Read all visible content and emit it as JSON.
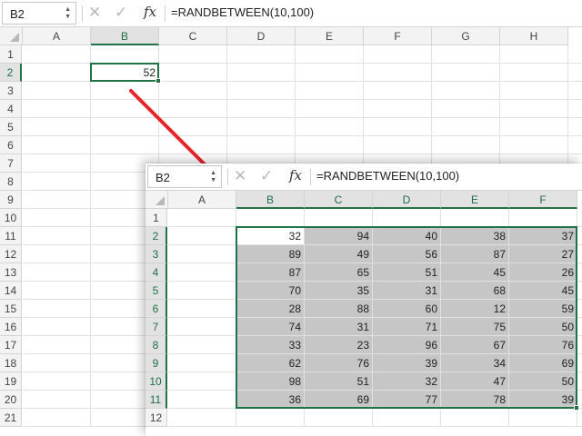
{
  "main": {
    "name_box": "B2",
    "formula": "=RANDBETWEEN(10,100)",
    "columns": [
      "A",
      "B",
      "C",
      "D",
      "E",
      "F",
      "G",
      "H"
    ],
    "rows": [
      "1",
      "2",
      "3",
      "4",
      "5",
      "6",
      "7",
      "8",
      "9",
      "10",
      "11",
      "12",
      "13",
      "14",
      "15",
      "16",
      "17",
      "18",
      "19",
      "20",
      "21"
    ],
    "selected_value": "52"
  },
  "inset": {
    "name_box": "B2",
    "formula": "=RANDBETWEEN(10,100)",
    "columns": [
      "A",
      "B",
      "C",
      "D",
      "E",
      "F"
    ],
    "rows": [
      "1",
      "2",
      "3",
      "4",
      "5",
      "6",
      "7",
      "8",
      "9",
      "10",
      "11",
      "12"
    ],
    "values": [
      [
        "32",
        "94",
        "40",
        "38",
        "37"
      ],
      [
        "89",
        "49",
        "56",
        "87",
        "27"
      ],
      [
        "87",
        "65",
        "51",
        "45",
        "26"
      ],
      [
        "70",
        "35",
        "31",
        "68",
        "45"
      ],
      [
        "28",
        "88",
        "60",
        "12",
        "59"
      ],
      [
        "74",
        "31",
        "71",
        "75",
        "50"
      ],
      [
        "33",
        "23",
        "96",
        "67",
        "76"
      ],
      [
        "62",
        "76",
        "39",
        "34",
        "69"
      ],
      [
        "98",
        "51",
        "32",
        "47",
        "50"
      ],
      [
        "36",
        "69",
        "77",
        "78",
        "39"
      ]
    ]
  },
  "icons": {
    "cancel": "✕",
    "enter": "✓",
    "fx": "fx",
    "namebox_arrows": "▲▼",
    "arrow": "red-arrow"
  },
  "colors": {
    "accent": "#217346",
    "arrow": "#e8262b",
    "selection_fill": "#c6c6c6"
  }
}
